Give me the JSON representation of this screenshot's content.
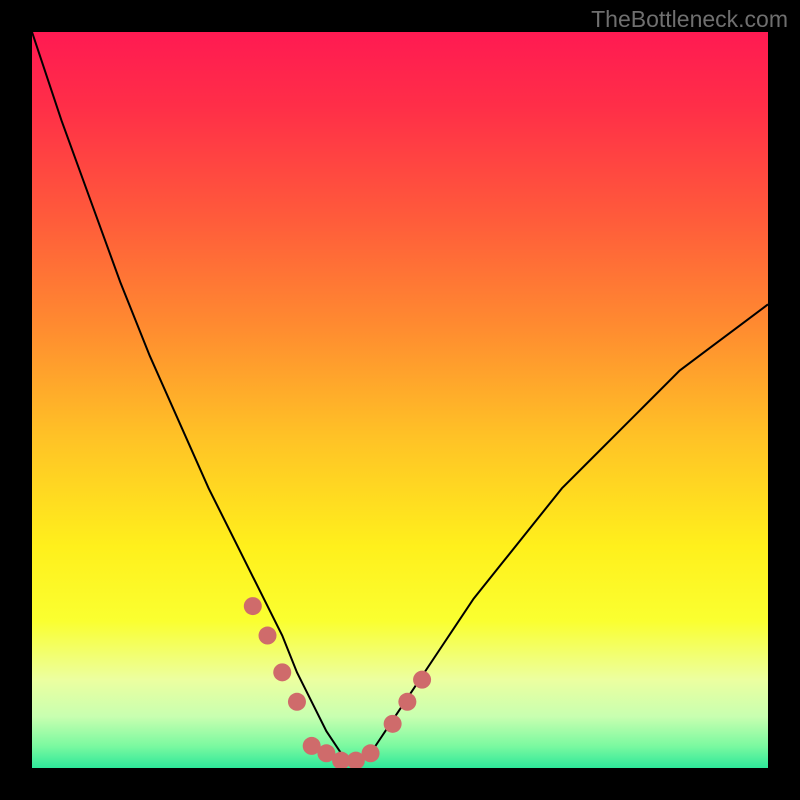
{
  "watermark": "TheBottleneck.com",
  "chart_data": {
    "type": "line",
    "title": "",
    "xlabel": "",
    "ylabel": "",
    "xlim": [
      0,
      100
    ],
    "ylim": [
      0,
      100
    ],
    "grid": false,
    "series": [
      {
        "name": "bottleneck-curve",
        "x": [
          0,
          4,
          8,
          12,
          16,
          20,
          24,
          28,
          30,
          32,
          34,
          36,
          38,
          40,
          42,
          44,
          46,
          48,
          52,
          56,
          60,
          64,
          68,
          72,
          76,
          80,
          84,
          88,
          92,
          96,
          100
        ],
        "y": [
          100,
          88,
          77,
          66,
          56,
          47,
          38,
          30,
          26,
          22,
          18,
          13,
          9,
          5,
          2,
          1,
          2,
          5,
          11,
          17,
          23,
          28,
          33,
          38,
          42,
          46,
          50,
          54,
          57,
          60,
          63
        ]
      }
    ],
    "annotations": [
      {
        "name": "valley-marker-left-1",
        "x": 30,
        "y": 22,
        "color": "#cf6b6b"
      },
      {
        "name": "valley-marker-left-2",
        "x": 32,
        "y": 18,
        "color": "#cf6b6b"
      },
      {
        "name": "valley-marker-left-3",
        "x": 34,
        "y": 13,
        "color": "#cf6b6b"
      },
      {
        "name": "valley-marker-left-4",
        "x": 36,
        "y": 9,
        "color": "#cf6b6b"
      },
      {
        "name": "valley-marker-bottom-1",
        "x": 38,
        "y": 3,
        "color": "#cf6b6b"
      },
      {
        "name": "valley-marker-bottom-2",
        "x": 40,
        "y": 2,
        "color": "#cf6b6b"
      },
      {
        "name": "valley-marker-bottom-3",
        "x": 42,
        "y": 1,
        "color": "#cf6b6b"
      },
      {
        "name": "valley-marker-bottom-4",
        "x": 44,
        "y": 1,
        "color": "#cf6b6b"
      },
      {
        "name": "valley-marker-bottom-5",
        "x": 46,
        "y": 2,
        "color": "#cf6b6b"
      },
      {
        "name": "valley-marker-right-1",
        "x": 49,
        "y": 6,
        "color": "#cf6b6b"
      },
      {
        "name": "valley-marker-right-2",
        "x": 51,
        "y": 9,
        "color": "#cf6b6b"
      },
      {
        "name": "valley-marker-right-3",
        "x": 53,
        "y": 12,
        "color": "#cf6b6b"
      }
    ],
    "background_gradient": {
      "stops": [
        {
          "offset": 0.0,
          "color": "#ff1a52"
        },
        {
          "offset": 0.1,
          "color": "#ff2e48"
        },
        {
          "offset": 0.25,
          "color": "#ff5a3b"
        },
        {
          "offset": 0.4,
          "color": "#ff8b30"
        },
        {
          "offset": 0.55,
          "color": "#ffc226"
        },
        {
          "offset": 0.7,
          "color": "#fff01c"
        },
        {
          "offset": 0.8,
          "color": "#faff30"
        },
        {
          "offset": 0.88,
          "color": "#ecffa0"
        },
        {
          "offset": 0.93,
          "color": "#c8ffb0"
        },
        {
          "offset": 0.97,
          "color": "#7bf9a0"
        },
        {
          "offset": 1.0,
          "color": "#2ee89a"
        }
      ]
    }
  }
}
